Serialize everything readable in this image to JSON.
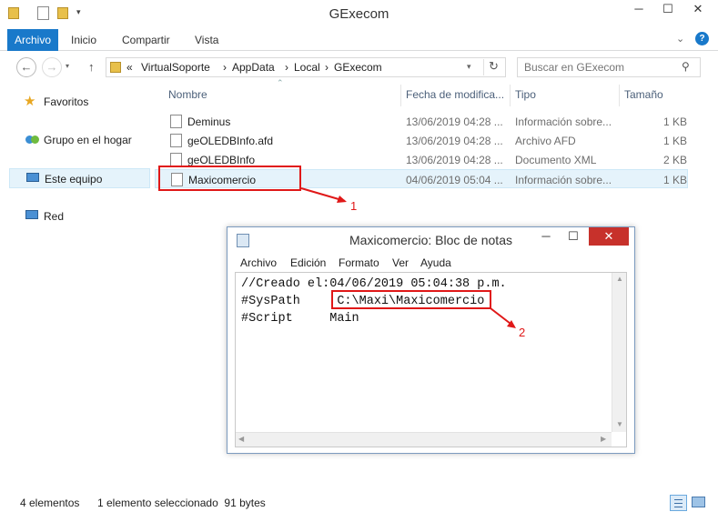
{
  "window": {
    "title": "GExecom"
  },
  "ribbon": {
    "tabs": [
      "Archivo",
      "Inicio",
      "Compartir",
      "Vista"
    ]
  },
  "address": {
    "overflow": "«",
    "path": [
      "VirtualSoporte",
      "AppData",
      "Local",
      "GExecom"
    ],
    "separator": "›"
  },
  "search": {
    "placeholder": "Buscar en GExecom"
  },
  "nav": {
    "items": [
      {
        "label": "Favoritos",
        "icon": "star-icon"
      },
      {
        "label": "Grupo en el hogar",
        "icon": "homegroup-icon"
      },
      {
        "label": "Este equipo",
        "icon": "computer-icon"
      },
      {
        "label": "Red",
        "icon": "network-icon"
      }
    ]
  },
  "columns": {
    "name": "Nombre",
    "date": "Fecha de modifica...",
    "type": "Tipo",
    "size": "Tamaño"
  },
  "files": [
    {
      "name": "Deminus",
      "date": "13/06/2019 04:28 ...",
      "type": "Información sobre...",
      "size": "1 KB",
      "icon": "config-file-icon"
    },
    {
      "name": "geOLEDBInfo.afd",
      "date": "13/06/2019 04:28 ...",
      "type": "Archivo AFD",
      "size": "1 KB",
      "icon": "blank-file-icon"
    },
    {
      "name": "geOLEDBInfo",
      "date": "13/06/2019 04:28 ...",
      "type": "Documento XML",
      "size": "2 KB",
      "icon": "xml-file-icon"
    },
    {
      "name": "Maxicomercio",
      "date": "04/06/2019 05:04 ...",
      "type": "Información sobre...",
      "size": "1 KB",
      "icon": "config-file-icon"
    }
  ],
  "status": {
    "count": "4 elementos",
    "selection": "1 elemento seleccionado  91 bytes"
  },
  "notepad": {
    "title": "Maxicomercio: Bloc de notas",
    "menu": [
      "Archivo",
      "Edición",
      "Formato",
      "Ver",
      "Ayuda"
    ],
    "lines": [
      "//Creado el:04/06/2019 05:04:38 p.m.",
      "#SysPath     C:\\Maxi\\Maxicomercio",
      "#Script     Main"
    ]
  },
  "annotations": {
    "label1": "1",
    "label2": "2"
  },
  "colors": {
    "accent": "#1979ca",
    "annotation": "#e01818",
    "close": "#c7312b",
    "selection": "#e5f3fb"
  }
}
